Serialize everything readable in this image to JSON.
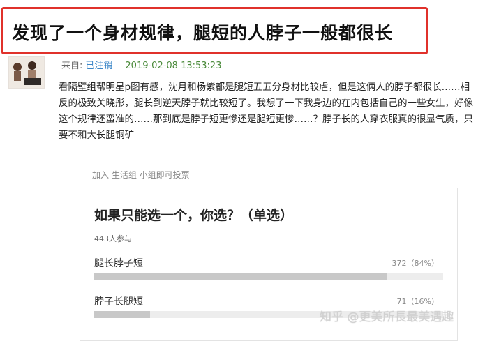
{
  "post": {
    "title": "发现了一个身材规律，腿短的人脖子一般都很长",
    "meta": {
      "from_label": "来自:",
      "author": "已注销",
      "timestamp": "2019-02-08 13:53:23"
    },
    "body": "看隔壁组帮明星p图有感，沈月和杨紫都是腿短五五分身材比较虐，但是这俩人的脖子都很长……相反的极致关晓彤，腿长到逆天脖子就比较短了。我想了一下我身边的在内包括自己的一些女生，好像这个规律还蛮准的……那到底是脖子短更惨还是腿短更惨……？脖子长的人穿衣服真的很显气质，只要不和大长腿铜矿",
    "join_hint": "加入 生活组 小组即可投票"
  },
  "poll": {
    "question": "如果只能选一个，你选？（单选）",
    "participants": "443人参与",
    "options": [
      {
        "label": "腿长脖子短",
        "result": "372（84%）",
        "fraction": 0.84
      },
      {
        "label": "脖子长腿短",
        "result": "71（16%）",
        "fraction": 0.16
      }
    ]
  },
  "watermark": "知乎 @更美所長最美遇趣",
  "colors": {
    "highlight_border": "#e0312b",
    "author_link": "#3c87c8",
    "timestamp": "#4a8a3a",
    "bar_fill": "#c8c8c8",
    "bar_track": "#ededed"
  }
}
